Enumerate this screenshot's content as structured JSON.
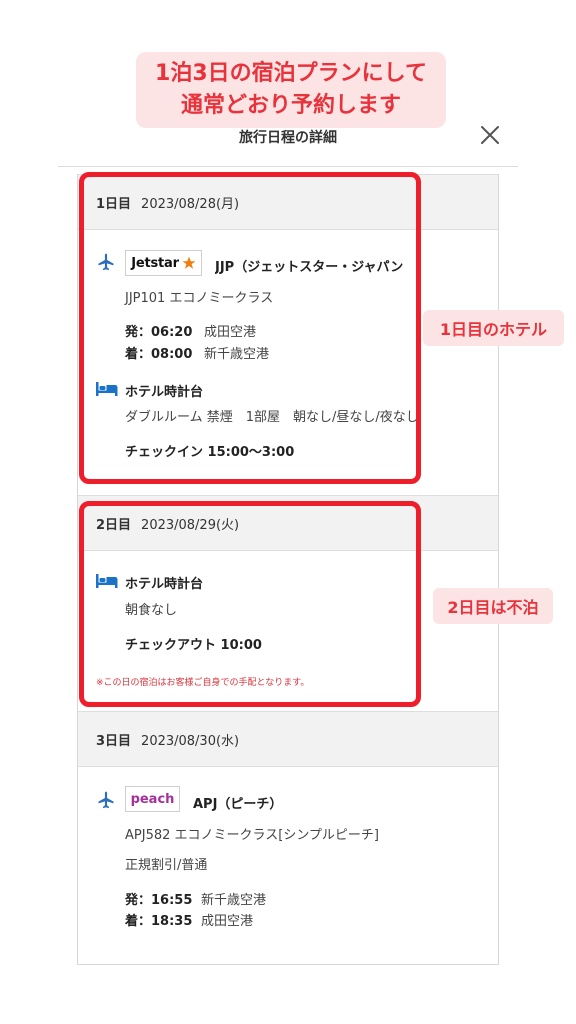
{
  "banner": {
    "line1": "1泊3日の宿泊プランにして",
    "line2": "通常どおり予約します"
  },
  "modal": {
    "title": "旅行日程の詳細",
    "close_icon": "close-icon"
  },
  "days": [
    {
      "label": "1日目",
      "date": "2023/08/28(月)",
      "flight": {
        "logo_text": "Jetstar",
        "airline": "JJP（ジェットスター・ジャパン",
        "number_class": "JJP101  エコノミークラス",
        "dep_label": "発：06:20",
        "dep_airport": "成田空港",
        "arr_label": "着：08:00",
        "arr_airport": "新千歳空港"
      },
      "hotel": {
        "name": "ホテル時計台",
        "room": "ダブルルーム 禁煙　1部屋　朝なし/昼なし/夜なし",
        "checkin": "チェックイン 15:00〜3:00"
      }
    },
    {
      "label": "2日目",
      "date": "2023/08/29(火)",
      "hotel": {
        "name": "ホテル時計台",
        "meal": "朝食なし",
        "checkout": "チェックアウト 10:00"
      },
      "note": "※この日の宿泊はお客様ご自身での手配となります。"
    },
    {
      "label": "3日目",
      "date": "2023/08/30(水)",
      "flight": {
        "logo_text": "peach",
        "airline": "APJ（ピーチ）",
        "number_class": "APJ582  エコノミークラス[シンプルピーチ]",
        "fare": "正規割引/普通",
        "dep_label": "発：16:55",
        "dep_airport": "新千歳空港",
        "arr_label": "着：18:35",
        "arr_airport": "成田空港"
      }
    }
  ],
  "callouts": {
    "day1": "1日目のホテル",
    "day2": "2日目は不泊"
  },
  "colors": {
    "accent_red": "#ee1e2a",
    "callout_bg": "#fde4e4",
    "plane_blue": "#2a6fb8",
    "bed_blue": "#1a73c7",
    "jetstar_orange": "#f07d10",
    "peach_purple": "#a4309c"
  }
}
